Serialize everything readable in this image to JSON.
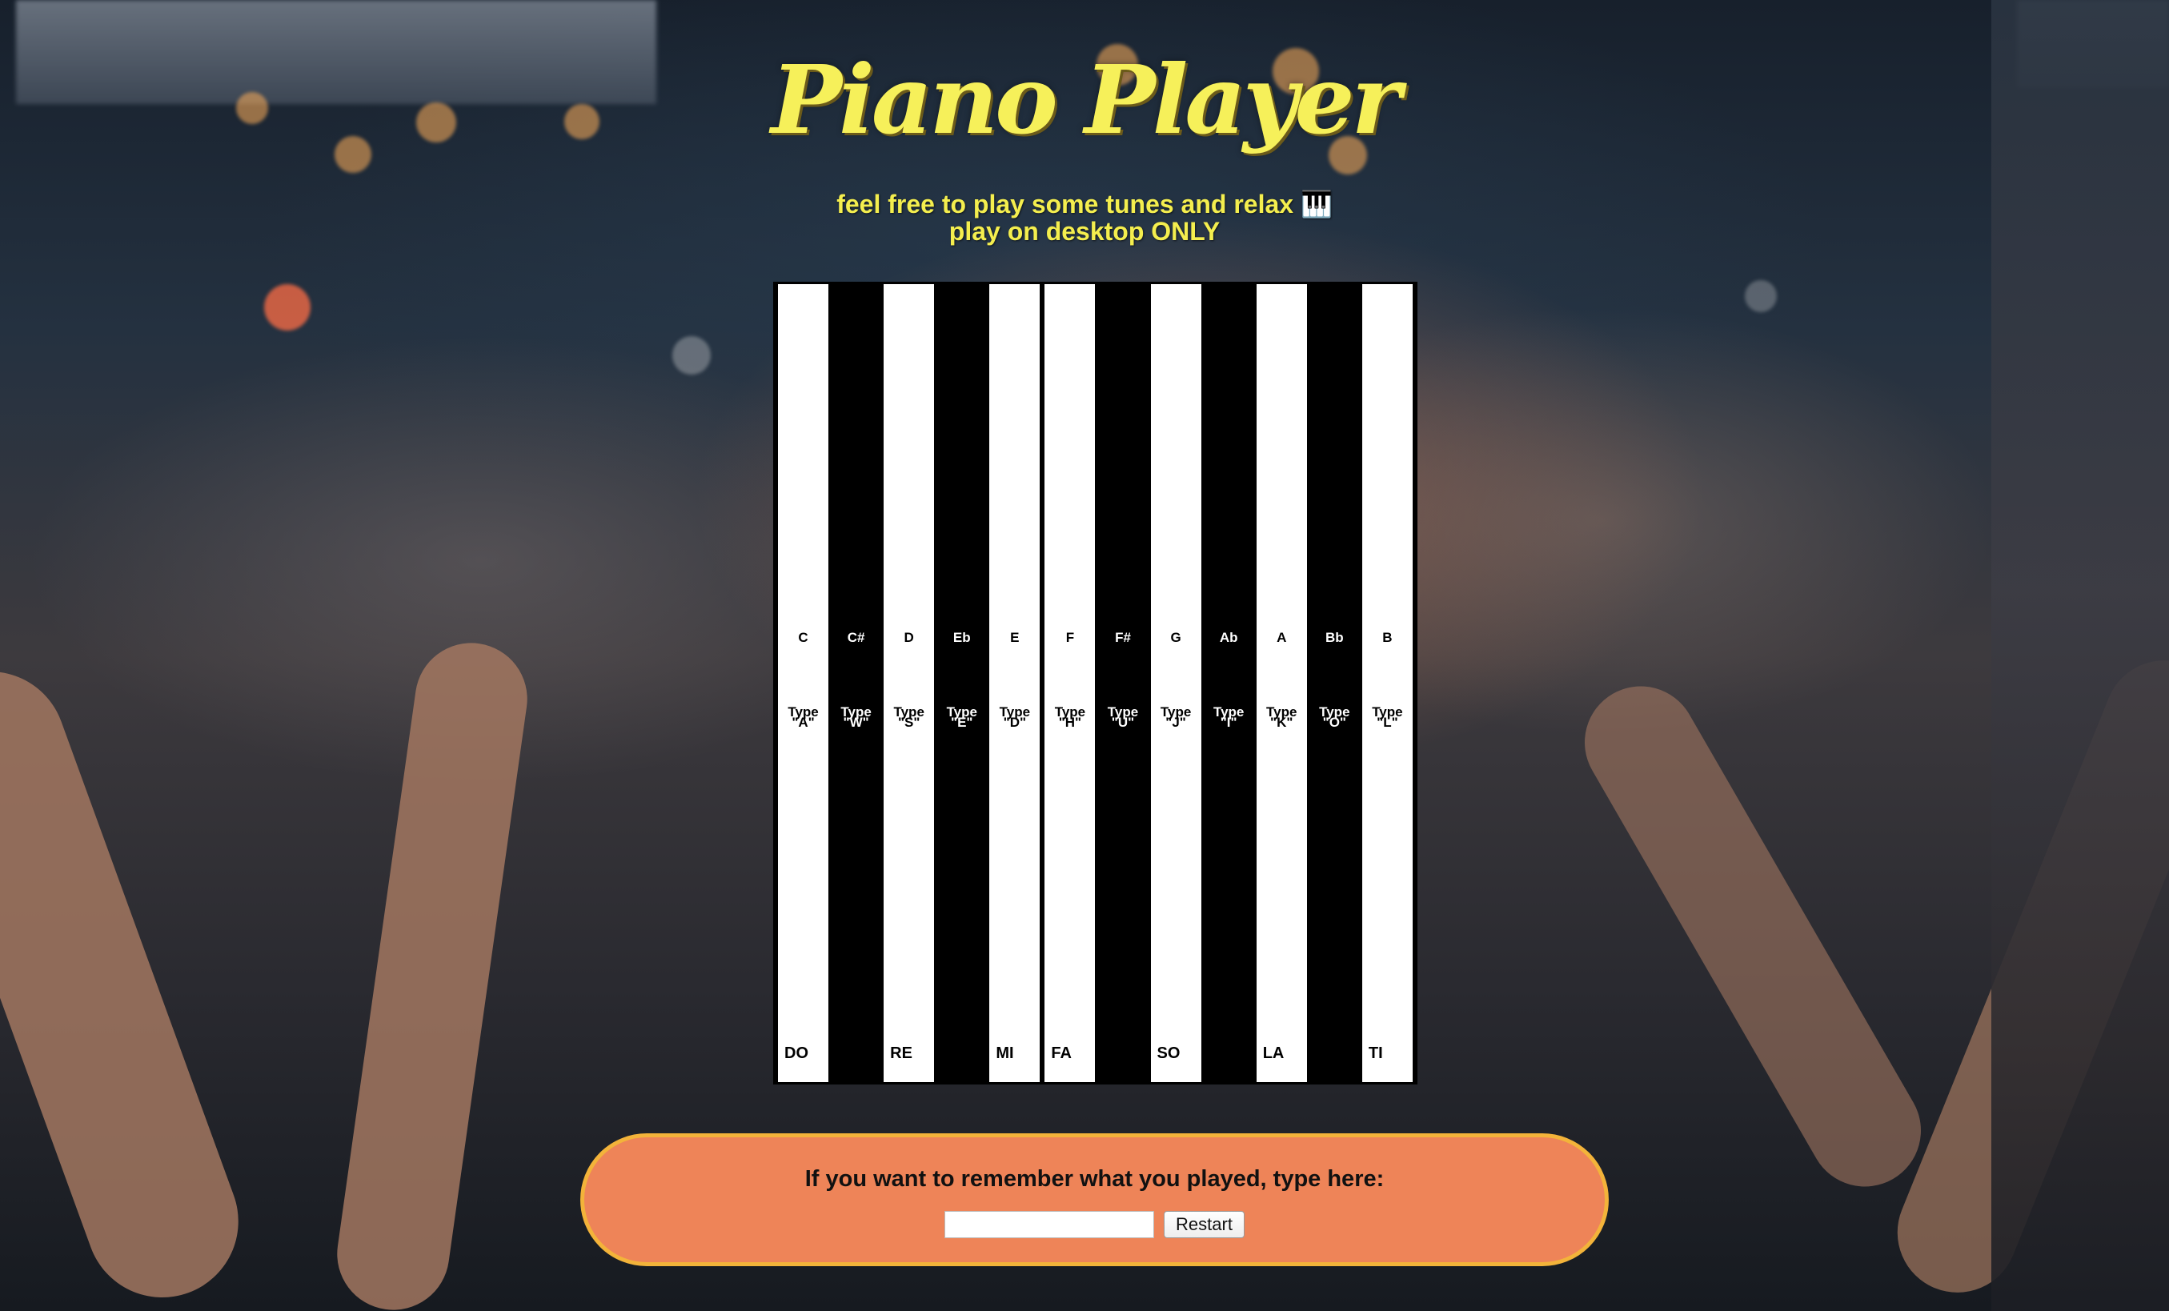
{
  "header": {
    "title": "Piano Player",
    "subtitle_line1": "feel free to play some tunes and relax 🎹",
    "subtitle_line2": "play on desktop ONLY"
  },
  "piano": {
    "keys": [
      {
        "color": "white",
        "note": "C",
        "type_label": "Type",
        "type_key": "\"A\"",
        "solfege": "DO"
      },
      {
        "color": "black",
        "note": "C#",
        "type_label": "Type",
        "type_key": "\"W\"",
        "solfege": ""
      },
      {
        "color": "white",
        "note": "D",
        "type_label": "Type",
        "type_key": "\"S\"",
        "solfege": "RE"
      },
      {
        "color": "black",
        "note": "Eb",
        "type_label": "Type",
        "type_key": "\"E\"",
        "solfege": ""
      },
      {
        "color": "white",
        "note": "E",
        "type_label": "Type",
        "type_key": "\"D\"",
        "solfege": "MI"
      },
      {
        "color": "white",
        "note": "F",
        "type_label": "Type",
        "type_key": "\"H\"",
        "solfege": "FA"
      },
      {
        "color": "black",
        "note": "F#",
        "type_label": "Type",
        "type_key": "\"U\"",
        "solfege": ""
      },
      {
        "color": "white",
        "note": "G",
        "type_label": "Type",
        "type_key": "\"J\"",
        "solfege": "SO"
      },
      {
        "color": "black",
        "note": "Ab",
        "type_label": "Type",
        "type_key": "\"I\"",
        "solfege": ""
      },
      {
        "color": "white",
        "note": "A",
        "type_label": "Type",
        "type_key": "\"K\"",
        "solfege": "LA"
      },
      {
        "color": "black",
        "note": "Bb",
        "type_label": "Type",
        "type_key": "\"O\"",
        "solfege": ""
      },
      {
        "color": "white",
        "note": "B",
        "type_label": "Type",
        "type_key": "\"L\"",
        "solfege": "TI"
      }
    ]
  },
  "memo": {
    "label": "If you want to remember what you played, type here:",
    "input_value": "",
    "restart_label": "Restart"
  },
  "colors": {
    "title": "#f6f05a",
    "panel_background": "#ee8458",
    "panel_border": "#f3b33a"
  }
}
